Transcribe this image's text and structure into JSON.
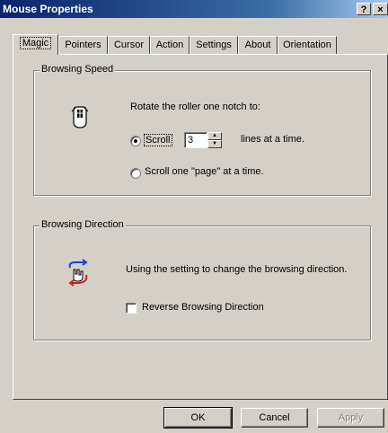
{
  "window": {
    "title": "Mouse Properties",
    "help_label": "?",
    "close_label": "×"
  },
  "tabs": [
    "Magic",
    "Pointers",
    "Cursor",
    "Action",
    "Settings",
    "About",
    "Orientation"
  ],
  "browsing_speed": {
    "group_label": "Browsing Speed",
    "instruction": "Rotate the roller one notch to:",
    "scroll_label": "Scroll",
    "scroll_value": "3",
    "lines_suffix": "lines at a time.",
    "page_option_label": "Scroll one \"page\" at a time.",
    "selected_option": "scroll-lines",
    "icon": "mouse-roller-icon"
  },
  "browsing_direction": {
    "group_label": "Browsing Direction",
    "description": "Using the setting to change the browsing direction.",
    "reverse_label": "Reverse Browsing Direction",
    "reverse_checked": false,
    "icon": "hand-direction-icon"
  },
  "buttons": {
    "ok": "OK",
    "cancel": "Cancel",
    "apply": "Apply"
  }
}
